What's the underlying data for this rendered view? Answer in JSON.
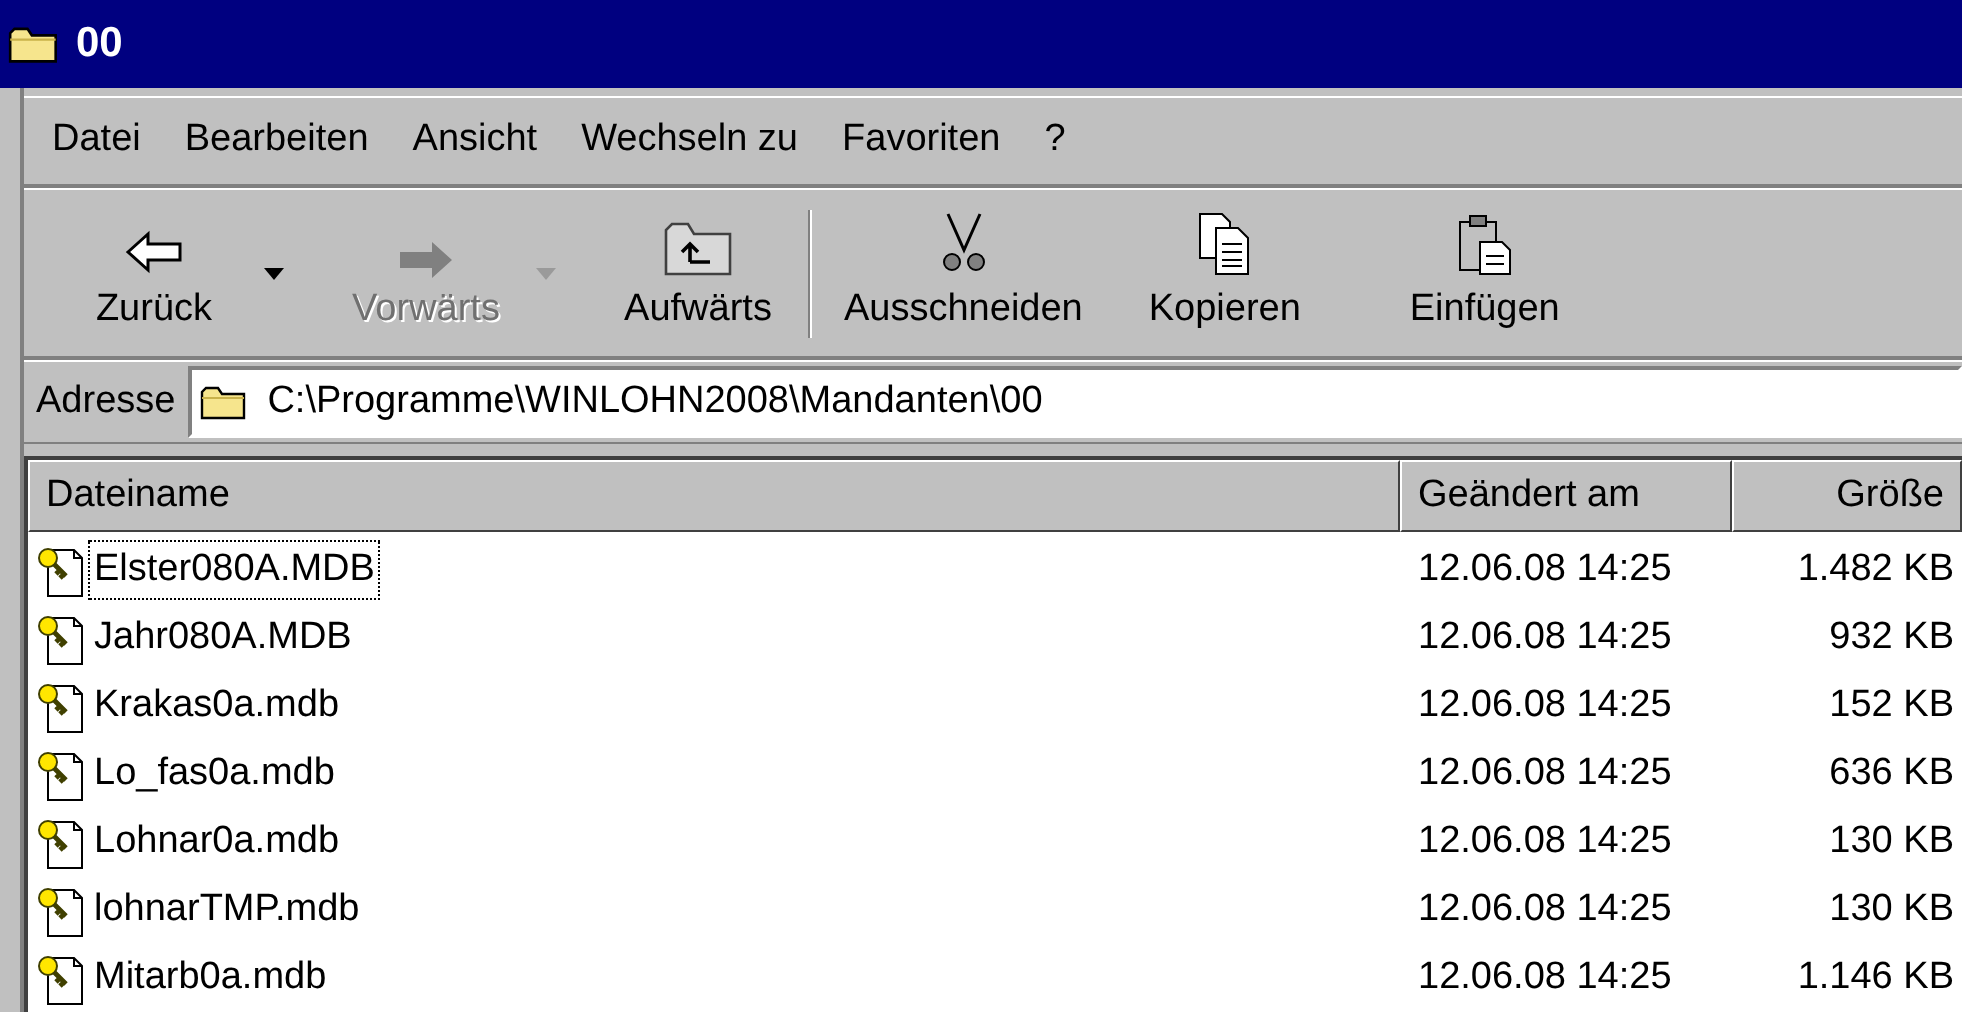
{
  "window": {
    "title": "00"
  },
  "menu": [
    {
      "label": "Datei"
    },
    {
      "label": "Bearbeiten"
    },
    {
      "label": "Ansicht"
    },
    {
      "label": "Wechseln zu"
    },
    {
      "label": "Favoriten"
    },
    {
      "label": "?"
    }
  ],
  "toolbar": [
    {
      "label": "Zurück",
      "disabled": false,
      "dropdown": true
    },
    {
      "label": "Vorwärts",
      "disabled": true,
      "dropdown": true
    },
    {
      "label": "Aufwärts",
      "disabled": false,
      "dropdown": false
    },
    {
      "label": "Ausschneiden",
      "disabled": false,
      "dropdown": false
    },
    {
      "label": "Kopieren",
      "disabled": false,
      "dropdown": false
    },
    {
      "label": "Einfügen",
      "disabled": false,
      "dropdown": false
    }
  ],
  "address": {
    "label": "Adresse",
    "value": "C:\\Programme\\WINLOHN2008\\Mandanten\\00"
  },
  "table": {
    "columns": [
      "Dateiname",
      "Geändert am",
      "Größe"
    ],
    "rows": [
      {
        "name": "Elster080A.MDB",
        "modified": "12.06.08 14:25",
        "size": "1.482 KB",
        "focused": true
      },
      {
        "name": "Jahr080A.MDB",
        "modified": "12.06.08 14:25",
        "size": "932 KB",
        "focused": false
      },
      {
        "name": "Krakas0a.mdb",
        "modified": "12.06.08 14:25",
        "size": "152 KB",
        "focused": false
      },
      {
        "name": "Lo_fas0a.mdb",
        "modified": "12.06.08 14:25",
        "size": "636 KB",
        "focused": false
      },
      {
        "name": "Lohnar0a.mdb",
        "modified": "12.06.08 14:25",
        "size": "130 KB",
        "focused": false
      },
      {
        "name": "lohnarTMP.mdb",
        "modified": "12.06.08 14:25",
        "size": "130 KB",
        "focused": false
      },
      {
        "name": "Mitarb0a.mdb",
        "modified": "12.06.08 14:25",
        "size": "1.146 KB",
        "focused": false
      }
    ]
  }
}
